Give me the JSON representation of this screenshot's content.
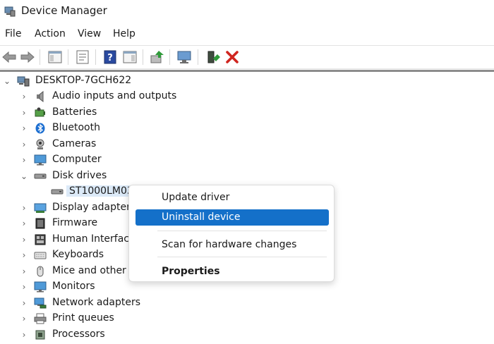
{
  "window": {
    "title": "Device Manager"
  },
  "menu": [
    "File",
    "Action",
    "View",
    "Help"
  ],
  "toolbar": [
    {
      "icon": "back-arrow-icon"
    },
    {
      "icon": "forward-arrow-icon"
    },
    {
      "icon": "show-hide-tree-icon"
    },
    {
      "icon": "properties-sheet-icon"
    },
    {
      "icon": "help-icon"
    },
    {
      "icon": "action-pane-icon"
    },
    {
      "icon": "update-driver-icon"
    },
    {
      "icon": "scan-hardware-icon"
    },
    {
      "icon": "enable-device-icon"
    },
    {
      "icon": "uninstall-x-icon"
    }
  ],
  "tree": {
    "root": "DESKTOP-7GCH622",
    "items": [
      {
        "label": "Audio inputs and outputs",
        "icon": "speaker-icon",
        "expanded": false
      },
      {
        "label": "Batteries",
        "icon": "battery-icon",
        "expanded": false
      },
      {
        "label": "Bluetooth",
        "icon": "bluetooth-icon",
        "expanded": false
      },
      {
        "label": "Cameras",
        "icon": "camera-icon",
        "expanded": false
      },
      {
        "label": "Computer",
        "icon": "computer-icon",
        "expanded": false
      },
      {
        "label": "Disk drives",
        "icon": "disk-drive-icon",
        "expanded": true
      },
      {
        "label": "ST1000LM035",
        "icon": "disk-drive-icon",
        "child": true,
        "selected": true
      },
      {
        "label": "Display adapters",
        "icon": "display-adapter-icon",
        "expanded": false
      },
      {
        "label": "Firmware",
        "icon": "firmware-icon",
        "expanded": false
      },
      {
        "label": "Human Interface",
        "icon": "hid-icon",
        "expanded": false
      },
      {
        "label": "Keyboards",
        "icon": "keyboard-icon",
        "expanded": false
      },
      {
        "label": "Mice and other p",
        "icon": "mouse-icon",
        "expanded": false
      },
      {
        "label": "Monitors",
        "icon": "monitor-icon",
        "expanded": false
      },
      {
        "label": "Network adapters",
        "icon": "network-adapter-icon",
        "expanded": false
      },
      {
        "label": "Print queues",
        "icon": "printer-icon",
        "expanded": false
      },
      {
        "label": "Processors",
        "icon": "processor-icon",
        "expanded": false
      }
    ]
  },
  "context_menu": {
    "items": [
      {
        "label": "Update driver",
        "highlighted": false,
        "bold": false
      },
      {
        "label": "Uninstall device",
        "highlighted": true,
        "bold": false
      },
      {
        "label": "Scan for hardware changes",
        "highlighted": false,
        "bold": false
      },
      {
        "label": "Properties",
        "highlighted": false,
        "bold": true
      }
    ]
  },
  "colors": {
    "accent": "#1470c9",
    "selection": "#dceaf8",
    "uninstall_red": "#d0251f"
  }
}
